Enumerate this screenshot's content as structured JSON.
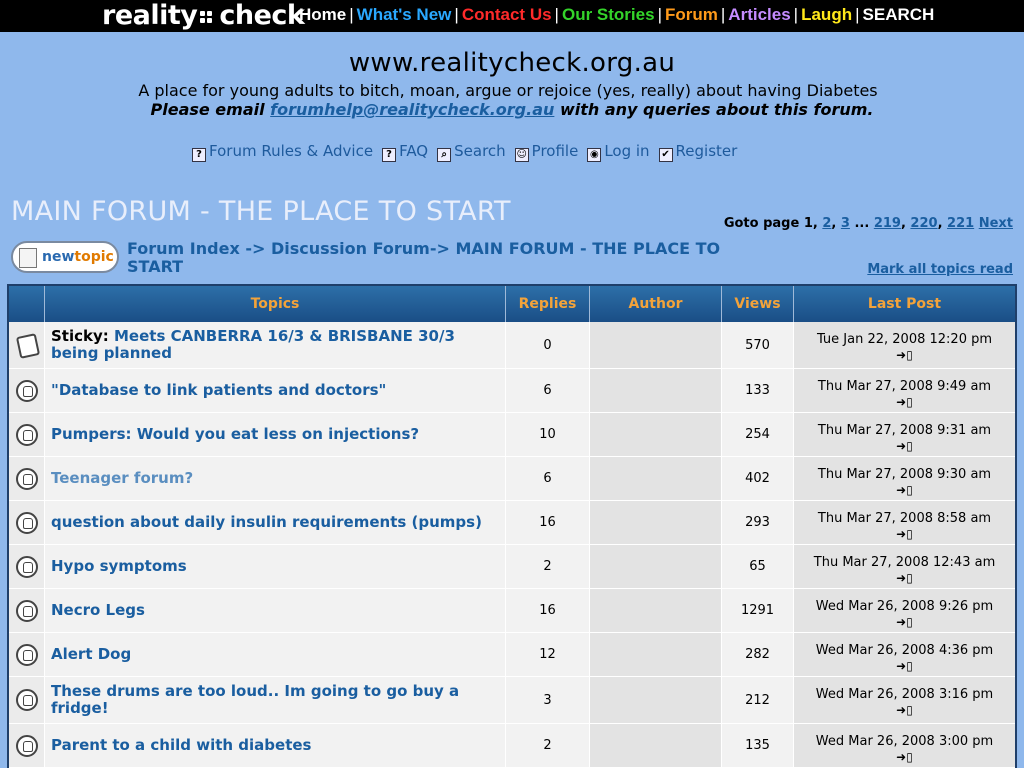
{
  "topbar": {
    "logo_left": "reality",
    "logo_right": "check",
    "nav": [
      {
        "label": "Home",
        "color": "#ffffff"
      },
      {
        "label": "What's New",
        "color": "#2aa8ff"
      },
      {
        "label": "Contact Us",
        "color": "#ff2a2a"
      },
      {
        "label": "Our Stories",
        "color": "#34d42a"
      },
      {
        "label": "Forum",
        "color": "#ff9a1a"
      },
      {
        "label": "Articles",
        "color": "#c58cff"
      },
      {
        "label": "Laugh",
        "color": "#ffe81a"
      },
      {
        "label": "SEARCH",
        "color": "#ffffff"
      }
    ]
  },
  "header": {
    "url": "www.realitycheck.org.au",
    "tagline": "A place for young adults to bitch, moan, argue or rejoice (yes, really) about having Diabetes",
    "email_prefix": "Please email",
    "email": "forumhelp@realitycheck.org.au",
    "email_suffix": "with any queries about this forum."
  },
  "links": [
    {
      "label": "Forum Rules & Advice",
      "icon": "question-icon",
      "glyph": "?"
    },
    {
      "label": "FAQ",
      "icon": "question-icon",
      "glyph": "?"
    },
    {
      "label": "Search",
      "icon": "search-icon",
      "glyph": "⌕"
    },
    {
      "label": "Profile",
      "icon": "profile-icon",
      "glyph": "☺"
    },
    {
      "label": "Log in",
      "icon": "login-icon",
      "glyph": "◉"
    },
    {
      "label": "Register",
      "icon": "register-icon",
      "glyph": "✔"
    }
  ],
  "forum": {
    "title": "MAIN FORUM - THE PLACE TO START",
    "goto_label": "Goto page",
    "pages": [
      "1",
      "2",
      "3",
      "...",
      "219",
      "220",
      "221"
    ],
    "next": "Next",
    "newtopic_a": "new",
    "newtopic_b": "topic",
    "crumb_index": "Forum Index",
    "crumb_discussion": "Discussion Forum",
    "crumb_main": "MAIN FORUM - THE PLACE TO START",
    "arrow": "->",
    "mark_read": "Mark all topics read"
  },
  "table": {
    "headers": [
      "Topics",
      "Replies",
      "Author",
      "Views",
      "Last Post"
    ],
    "go_icon": "➜▯",
    "rows": [
      {
        "sticky": "Sticky:",
        "title": "Meets CANBERRA 16/3 & BRISBANE 30/3 being planned",
        "replies": "0",
        "views": "570",
        "last": "Tue Jan 22, 2008 12:20 pm",
        "visited": false,
        "h": 47
      },
      {
        "sticky": "",
        "title": "\"Database to link patients and doctors\"",
        "replies": "6",
        "views": "133",
        "last": "Thu Mar 27, 2008 9:49 am",
        "visited": false,
        "h": 44
      },
      {
        "sticky": "",
        "title": "Pumpers: Would you eat less on injections?",
        "replies": "10",
        "views": "254",
        "last": "Thu Mar 27, 2008 9:31 am",
        "visited": false,
        "h": 44
      },
      {
        "sticky": "",
        "title": "Teenager forum?",
        "replies": "6",
        "views": "402",
        "last": "Thu Mar 27, 2008 9:30 am",
        "visited": true,
        "h": 44
      },
      {
        "sticky": "",
        "title": "question about daily insulin requirements (pumps)",
        "replies": "16",
        "views": "293",
        "last": "Thu Mar 27, 2008 8:58 am",
        "visited": false,
        "h": 44
      },
      {
        "sticky": "",
        "title": "Hypo symptoms",
        "replies": "2",
        "views": "65",
        "last": "Thu Mar 27, 2008 12:43 am",
        "visited": false,
        "h": 44
      },
      {
        "sticky": "",
        "title": "Necro Legs",
        "replies": "16",
        "views": "1291",
        "last": "Wed Mar 26, 2008 9:26 pm",
        "visited": false,
        "h": 44
      },
      {
        "sticky": "",
        "title": "Alert Dog",
        "replies": "12",
        "views": "282",
        "last": "Wed Mar 26, 2008 4:36 pm",
        "visited": false,
        "h": 44
      },
      {
        "sticky": "",
        "title": "These drums are too loud.. Im going to go buy a fridge!",
        "replies": "3",
        "views": "212",
        "last": "Wed Mar 26, 2008 3:16 pm",
        "visited": false,
        "h": 47
      },
      {
        "sticky": "",
        "title": "Parent to a child with diabetes",
        "replies": "2",
        "views": "135",
        "last": "Wed Mar 26, 2008 3:00 pm",
        "visited": false,
        "h": 44
      }
    ]
  }
}
